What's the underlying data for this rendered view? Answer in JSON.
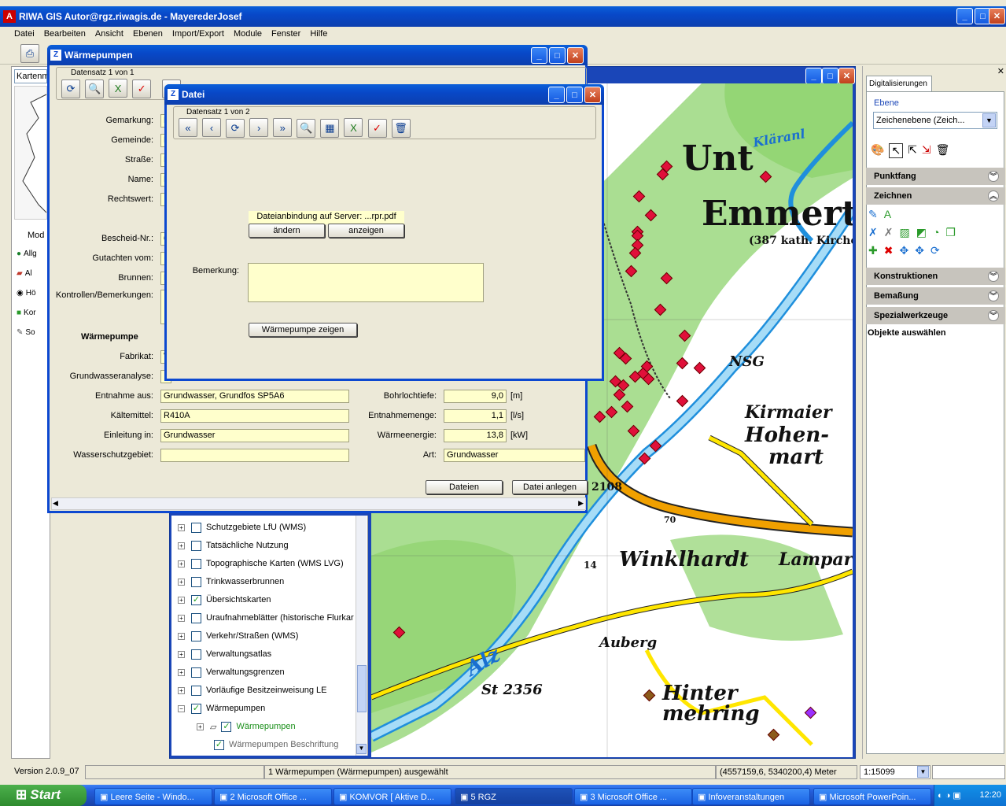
{
  "app": {
    "title": "RIWA GIS Autor@rgz.riwagis.de - MayerederJosef"
  },
  "menu": [
    "Datei",
    "Bearbeiten",
    "Ansicht",
    "Ebenen",
    "Import/Export",
    "Module",
    "Fenster",
    "Hilfe"
  ],
  "left_panel": {
    "combo": "Kartenm",
    "tab": "Mod",
    "items": [
      "Allg",
      "Al",
      "Hö",
      "Kor",
      "So"
    ]
  },
  "waermepumpen": {
    "title": "Wärmepumpen",
    "record": "Datensatz 1 von 1",
    "labels": {
      "gemarkung": "Gemarkung:",
      "gemeinde": "Gemeinde:",
      "strasse": "Straße:",
      "name": "Name:",
      "rechtswert": "Rechtswert:",
      "bescheid": "Bescheid-Nr.:",
      "gutachten": "Gutachten vom:",
      "brunnen": "Brunnen:",
      "kontrollen": "Kontrollen/Bemerkungen:",
      "section": "Wärmepumpe",
      "fabrikat": "Fabrikat:",
      "grundwasseranalyse": "Grundwasseranalyse:",
      "entnahme": "Entnahme aus:",
      "kaeltemittel": "Kältemittel:",
      "einleitung": "Einleitung in:",
      "wasserschutz": "Wasserschutzgebiet:",
      "bohrloch": "Bohrlochtiefe:",
      "entnahmemenge": "Entnahmemenge:",
      "waermeenergie": "Wärmeenergie:",
      "art": "Art:"
    },
    "values": {
      "gemarkung": "E",
      "gemeinde": "E",
      "strasse": "F",
      "name": "F",
      "bescheid": "6",
      "brunnen": "E",
      "fabrikat": "V",
      "entnahme": "Grundwasser, Grundfos SP5A6",
      "kaeltemittel": "R410A",
      "einleitung": "Grundwasser",
      "bohrloch": "9,0",
      "entnahmemenge": "1,1",
      "waermeenergie": "13,8",
      "art": "Grundwasser"
    },
    "units": {
      "bohrloch": "[m]",
      "entnahmemenge": "[l/s]",
      "waermeenergie": "[kW]"
    },
    "buttons": {
      "dateien": "Dateien",
      "datei_anlegen": "Datei anlegen"
    }
  },
  "datei": {
    "title": "Datei",
    "record": "Datensatz 1 von 2",
    "attachment": "Dateianbindung auf Server: ...rpr.pdf",
    "btn_aendern": "ändern",
    "btn_anzeigen": "anzeigen",
    "bemerkung_label": "Bemerkung:",
    "bemerkung_value": "",
    "btn_show": "Wärmepumpe zeigen"
  },
  "layers": [
    {
      "label": "Schutzgebiete LfU (WMS)",
      "checked": false
    },
    {
      "label": "Tatsächliche Nutzung",
      "checked": false
    },
    {
      "label": "Topographische Karten (WMS LVG)",
      "checked": false
    },
    {
      "label": "Trinkwasserbrunnen",
      "checked": false
    },
    {
      "label": "Übersichtskarten",
      "checked": true
    },
    {
      "label": "Uraufnahmeblätter (historische Flurkar",
      "checked": false
    },
    {
      "label": "Verkehr/Straßen (WMS)",
      "checked": false
    },
    {
      "label": "Verwaltungsatlas",
      "checked": false
    },
    {
      "label": "Verwaltungsgrenzen",
      "checked": false
    },
    {
      "label": "Vorläufige Besitzeinweisung LE",
      "checked": false
    },
    {
      "label": "Wärmepumpen",
      "checked": true
    },
    {
      "label": "Wärmepumpen",
      "checked": true
    },
    {
      "label": "Wärmepumpen Beschriftung",
      "checked": true
    }
  ],
  "map_labels": [
    "Unt",
    "Emmert",
    "(387 kath. Kirche",
    "Kläranl",
    "Kirmaier",
    "Hohen-",
    "mart",
    "Winklhardt",
    "Lampar",
    "Alz",
    "Auberg",
    "Hinter",
    "mehring",
    "St 2356",
    "NSG",
    "70",
    "2108",
    "14"
  ],
  "right_panel": {
    "tab": "Digitalisierungen",
    "ebene_label": "Ebene",
    "ebene_value": "Zeichenebene (Zeich...",
    "sections": [
      {
        "label": "Punktfang",
        "open": false
      },
      {
        "label": "Zeichnen",
        "open": true
      },
      {
        "label": "Konstruktionen",
        "open": false
      },
      {
        "label": "Bemaßung",
        "open": false
      },
      {
        "label": "Spezialwerkzeuge",
        "open": false
      }
    ],
    "objekte": "Objekte auswählen"
  },
  "statusbar": {
    "version": "Version 2.0.9_07",
    "selection": "1 Wärmepumpen (Wärmepumpen) ausgewählt",
    "coords": "(4557159,6, 5340200,4) Meter",
    "scale": "1:15099"
  },
  "taskbar": {
    "start": "Start",
    "items": [
      "Leere Seite - Windo...",
      "2 Microsoft Office ...",
      "KOMVOR [ Aktive D...",
      "5 RGZ",
      "3 Microsoft Office ...",
      "Infoveranstaltungen",
      "Microsoft PowerPoin..."
    ],
    "time": "12:20"
  }
}
